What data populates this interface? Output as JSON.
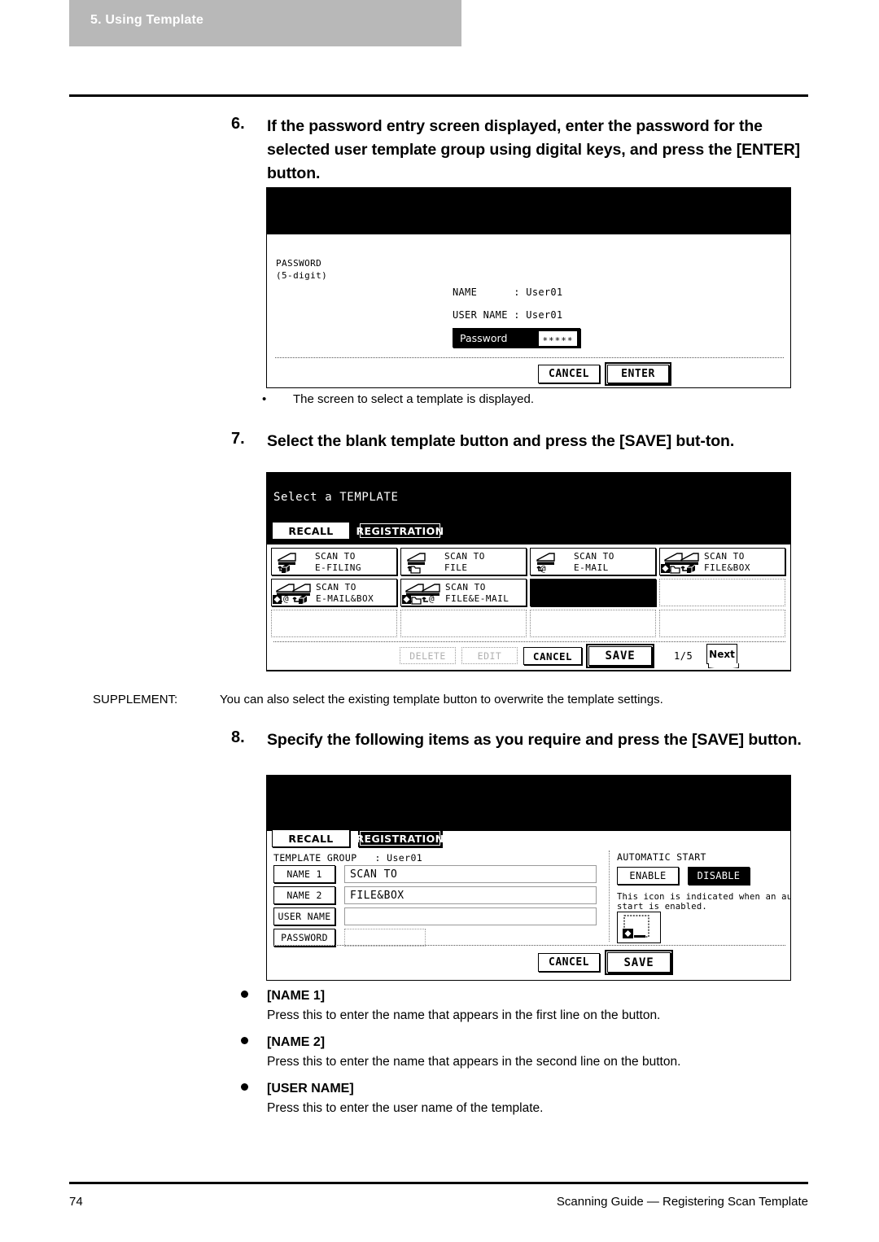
{
  "header": {
    "chapter": "5. Using Template"
  },
  "steps": {
    "s6": {
      "num": "6.",
      "text": "If the password entry screen displayed, enter the password for the selected user template group using digital keys, and press the [ENTER] button."
    },
    "s7": {
      "num": "7.",
      "text": "Select the blank template button and press the [SAVE] but-ton."
    },
    "s8": {
      "num": "8.",
      "text": "Specify the following items as you require and press the [SAVE] button."
    }
  },
  "notes": {
    "screen_displayed": {
      "bullet": "•",
      "text": "The screen to select a template is displayed."
    },
    "supplement": {
      "label": "SUPPLEMENT:",
      "text": "You can also select the existing template button to overwrite the template settings."
    }
  },
  "password_screen": {
    "password_label": "PASSWORD\n(5-digit)",
    "name_row": "NAME      : User01",
    "user_name_row": "USER NAME : User01",
    "field_caption": "Password",
    "field_colon": ":",
    "field_value": "∗∗∗∗∗",
    "cancel": "CANCEL",
    "enter": "ENTER"
  },
  "template_screen": {
    "title": "Select a TEMPLATE",
    "tab_recall": "RECALL",
    "tab_registration": "REGISTRATION",
    "buttons": [
      {
        "line1": "SCAN TO",
        "line2": "E-FILING",
        "icon": "scanner-to-efiling-icon",
        "state": "filled"
      },
      {
        "line1": "SCAN TO",
        "line2": "FILE",
        "icon": "scanner-to-file-icon",
        "state": "filled"
      },
      {
        "line1": "SCAN TO",
        "line2": "E-MAIL",
        "icon": "scanner-to-email-icon",
        "state": "filled"
      },
      {
        "line1": "SCAN TO",
        "line2": "FILE&BOX",
        "icon": "scanner-to-filebox-icon",
        "state": "filled"
      },
      {
        "line1": "SCAN TO",
        "line2": "E-MAIL&BOX",
        "icon": "scanner-to-emailbox-icon",
        "state": "filled"
      },
      {
        "line1": "SCAN TO",
        "line2": "FILE&E-MAIL",
        "icon": "scanner-to-fileemail-icon",
        "state": "filled"
      },
      {
        "line1": "",
        "line2": "",
        "icon": "",
        "state": "selected"
      },
      {
        "line1": "",
        "line2": "",
        "icon": "",
        "state": "empty"
      },
      {
        "line1": "",
        "line2": "",
        "icon": "",
        "state": "empty"
      },
      {
        "line1": "",
        "line2": "",
        "icon": "",
        "state": "empty"
      },
      {
        "line1": "",
        "line2": "",
        "icon": "",
        "state": "empty"
      },
      {
        "line1": "",
        "line2": "",
        "icon": "",
        "state": "empty"
      }
    ],
    "delete": "DELETE",
    "edit": "EDIT",
    "cancel": "CANCEL",
    "save": "SAVE",
    "page_indicator": "1/5",
    "next": "Next"
  },
  "registration_screen": {
    "tab_recall": "RECALL",
    "tab_registration": "REGISTRATION",
    "template_group": "TEMPLATE GROUP   : User01",
    "fields": [
      {
        "key": "NAME 1",
        "value": "SCAN TO"
      },
      {
        "key": "NAME 2",
        "value": "FILE&BOX"
      },
      {
        "key": "USER NAME",
        "value": ""
      },
      {
        "key": "PASSWORD",
        "value": ""
      }
    ],
    "automatic_start_title": "AUTOMATIC START",
    "enable": "ENABLE",
    "disable": "DISABLE",
    "icon_note": "This icon is indicated when an automatic\nstart is enabled.",
    "cancel": "CANCEL",
    "save": "SAVE"
  },
  "definitions": [
    {
      "term": "[NAME 1]",
      "desc": "Press this to enter the name that appears in the first line on the button."
    },
    {
      "term": "[NAME 2]",
      "desc": "Press this to enter the name that appears in the second line on the button."
    },
    {
      "term": "[USER NAME]",
      "desc": "Press this to enter the user name of the template."
    }
  ],
  "footer": {
    "page": "74",
    "title": "Scanning Guide — Registering Scan Template"
  },
  "colors": {
    "chapter_tab_bg": "#b8b8b8",
    "lcd_header": "#000000",
    "page_bg": "#ffffff"
  }
}
